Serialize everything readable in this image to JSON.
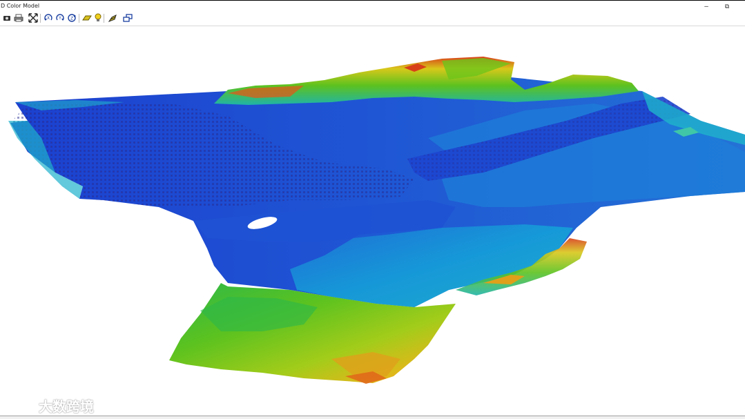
{
  "window": {
    "title": "D Color Model",
    "minimize_label": "–",
    "restore_label": "⧉"
  },
  "toolbar": {
    "icons": [
      "camera-icon",
      "print-icon",
      "zoom-extents-icon",
      "rotate-x-icon",
      "rotate-y-icon",
      "rotate-z-icon",
      "light-source-icon",
      "bulb-icon",
      "wireframe-icon",
      "window-icon"
    ]
  },
  "scene": {
    "type": "3d-terrain-color-model",
    "color_scale": [
      "#1a3fd1",
      "#1f6fd6",
      "#14a8d9",
      "#1fc0c0",
      "#1fb85a",
      "#6ec41a",
      "#c9d21a",
      "#f0b21a",
      "#e05a1a",
      "#c0301a"
    ]
  },
  "watermark": {
    "text": "大数跨境"
  }
}
